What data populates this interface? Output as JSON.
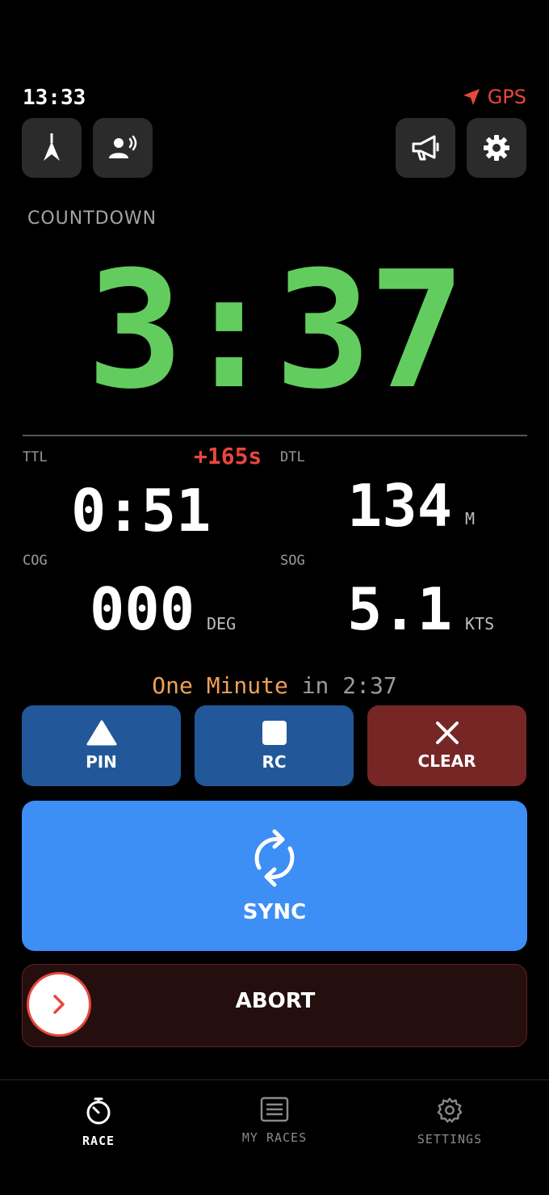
{
  "status": {
    "time": "13:33",
    "gps_label": "GPS"
  },
  "colors": {
    "accent_green": "#62cd5e",
    "alert_red": "#e9473b",
    "pin_blue": "#22589a",
    "clear_red": "#772626",
    "sync_blue": "#3d8ef5"
  },
  "toolbar": {
    "icons": [
      "north-arrow-icon",
      "voice-icon",
      "megaphone-icon",
      "gear-icon"
    ]
  },
  "countdown": {
    "label": "COUNTDOWN",
    "value": "3:37"
  },
  "metrics": {
    "ttl": {
      "label": "TTL",
      "value": "0:51"
    },
    "delta": "+165s",
    "dtl": {
      "label": "DTL",
      "value": "134",
      "unit": "M"
    },
    "cog": {
      "label": "COG",
      "value": "000",
      "unit": "DEG"
    },
    "sog": {
      "label": "SOG",
      "value": "5.1",
      "unit": "KTS"
    }
  },
  "next_signal": {
    "name": "One Minute",
    "connector": "in",
    "time": "2:37"
  },
  "actions": {
    "pin": "PIN",
    "rc": "RC",
    "clear": "CLEAR"
  },
  "sync_label": "SYNC",
  "abort_label": "ABORT",
  "tabs": [
    {
      "label": "RACE",
      "icon": "stopwatch-icon",
      "active": true
    },
    {
      "label": "MY RACES",
      "icon": "list-icon",
      "active": false
    },
    {
      "label": "SETTINGS",
      "icon": "gear-icon",
      "active": false
    }
  ]
}
